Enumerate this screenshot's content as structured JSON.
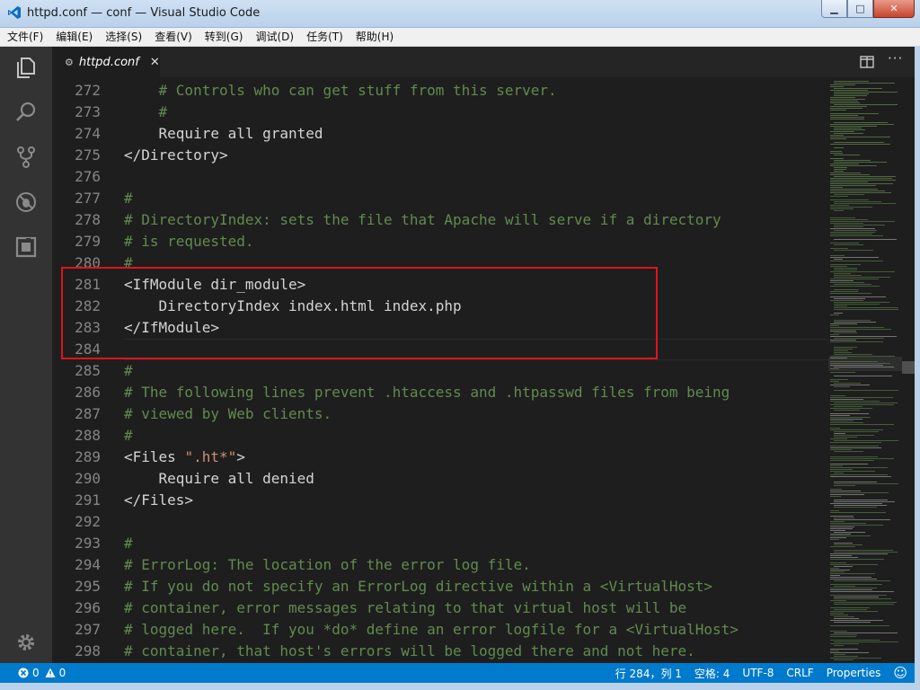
{
  "window": {
    "title": "httpd.conf — conf — Visual Studio Code",
    "minimize": "▁",
    "maximize": "□",
    "close": "✕"
  },
  "menu": [
    "文件(F)",
    "编辑(E)",
    "选择(S)",
    "查看(V)",
    "转到(G)",
    "调试(D)",
    "任务(T)",
    "帮助(H)"
  ],
  "activity_bar": [
    "files-icon",
    "search-icon",
    "source-control-icon",
    "debug-icon",
    "extensions-icon",
    "settings-icon"
  ],
  "tab": {
    "label": "httpd.conf",
    "icon": "⚙",
    "close": "✕"
  },
  "editor_actions": {
    "more": "···"
  },
  "lines": [
    {
      "n": "272",
      "parts": [
        {
          "t": "    # Controls who can get stuff from this server.",
          "c": "comment"
        }
      ]
    },
    {
      "n": "273",
      "parts": [
        {
          "t": "    #",
          "c": "comment"
        }
      ]
    },
    {
      "n": "274",
      "parts": [
        {
          "t": "    Require all granted",
          "c": "text"
        }
      ]
    },
    {
      "n": "275",
      "parts": [
        {
          "t": "</Directory>",
          "c": "text"
        }
      ]
    },
    {
      "n": "276",
      "parts": [
        {
          "t": "",
          "c": "text"
        }
      ]
    },
    {
      "n": "277",
      "parts": [
        {
          "t": "#",
          "c": "comment"
        }
      ]
    },
    {
      "n": "278",
      "parts": [
        {
          "t": "# DirectoryIndex: sets the file that Apache will serve if a directory",
          "c": "comment"
        }
      ]
    },
    {
      "n": "279",
      "parts": [
        {
          "t": "# is requested.",
          "c": "comment"
        }
      ]
    },
    {
      "n": "280",
      "parts": [
        {
          "t": "#",
          "c": "comment"
        }
      ]
    },
    {
      "n": "281",
      "parts": [
        {
          "t": "<IfModule dir_module>",
          "c": "text"
        }
      ]
    },
    {
      "n": "282",
      "parts": [
        {
          "t": "    DirectoryIndex index.html index.php",
          "c": "text"
        }
      ]
    },
    {
      "n": "283",
      "parts": [
        {
          "t": "</IfModule>",
          "c": "text"
        }
      ]
    },
    {
      "n": "284",
      "parts": [
        {
          "t": "",
          "c": "text"
        }
      ]
    },
    {
      "n": "285",
      "parts": [
        {
          "t": "#",
          "c": "comment"
        }
      ]
    },
    {
      "n": "286",
      "parts": [
        {
          "t": "# The following lines prevent .htaccess and .htpasswd files from being",
          "c": "comment"
        }
      ]
    },
    {
      "n": "287",
      "parts": [
        {
          "t": "# viewed by Web clients.",
          "c": "comment"
        }
      ]
    },
    {
      "n": "288",
      "parts": [
        {
          "t": "#",
          "c": "comment"
        }
      ]
    },
    {
      "n": "289",
      "parts": [
        {
          "t": "<Files ",
          "c": "text"
        },
        {
          "t": "\".ht*\"",
          "c": "string"
        },
        {
          "t": ">",
          "c": "text"
        }
      ]
    },
    {
      "n": "290",
      "parts": [
        {
          "t": "    Require all denied",
          "c": "text"
        }
      ]
    },
    {
      "n": "291",
      "parts": [
        {
          "t": "</Files>",
          "c": "text"
        }
      ]
    },
    {
      "n": "292",
      "parts": [
        {
          "t": "",
          "c": "text"
        }
      ]
    },
    {
      "n": "293",
      "parts": [
        {
          "t": "#",
          "c": "comment"
        }
      ]
    },
    {
      "n": "294",
      "parts": [
        {
          "t": "# ErrorLog: The location of the error log file.",
          "c": "comment"
        }
      ]
    },
    {
      "n": "295",
      "parts": [
        {
          "t": "# If you do not specify an ErrorLog directive within a <VirtualHost>",
          "c": "comment"
        }
      ]
    },
    {
      "n": "296",
      "parts": [
        {
          "t": "# container, error messages relating to that virtual host will be",
          "c": "comment"
        }
      ]
    },
    {
      "n": "297",
      "parts": [
        {
          "t": "# logged here.  If you *do* define an error logfile for a <VirtualHost>",
          "c": "comment"
        }
      ]
    },
    {
      "n": "298",
      "parts": [
        {
          "t": "# container, that host's errors will be logged there and not here.",
          "c": "comment"
        }
      ]
    }
  ],
  "status": {
    "errors": "0",
    "warnings": "0",
    "position": "行 284，列 1",
    "spaces": "空格: 4",
    "encoding": "UTF-8",
    "eol": "CRLF",
    "language": "Properties",
    "feedback": "☺"
  },
  "colors": {
    "editor_bg": "#1e1e1e",
    "comment": "#608b4e",
    "text": "#d4d4d4",
    "string": "#ce9178",
    "status_bar": "#007acc",
    "highlight_border": "#e0141b"
  }
}
